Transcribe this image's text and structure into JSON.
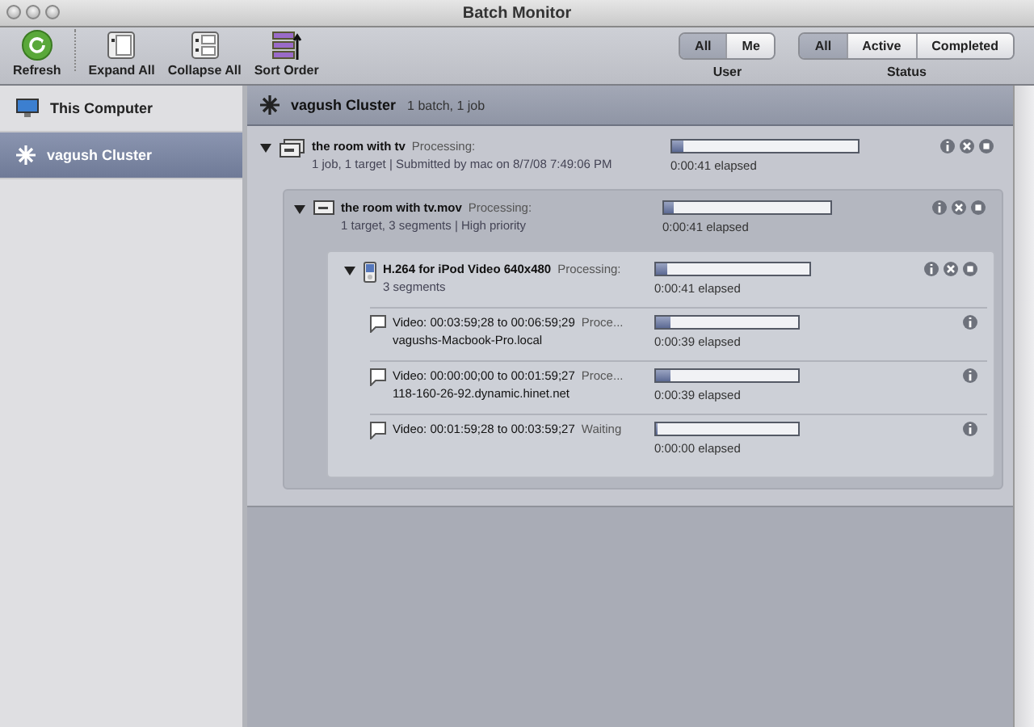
{
  "window": {
    "title": "Batch Monitor"
  },
  "toolbar": {
    "buttons": [
      {
        "label": "Refresh",
        "kind": "refresh"
      },
      {
        "label": "Expand All",
        "kind": "expand"
      },
      {
        "label": "Collapse All",
        "kind": "collapse"
      },
      {
        "label": "Sort Order",
        "kind": "sort"
      }
    ],
    "filters": [
      {
        "label": "User",
        "options": [
          {
            "label": "All",
            "selected": true
          },
          {
            "label": "Me",
            "selected": false
          }
        ]
      },
      {
        "label": "Status",
        "options": [
          {
            "label": "All",
            "selected": true
          },
          {
            "label": "Active",
            "selected": false
          },
          {
            "label": "Completed",
            "selected": false
          }
        ]
      }
    ]
  },
  "sidebar": {
    "items": [
      {
        "label": "This Computer",
        "kind": "computer",
        "selected": false
      },
      {
        "label": "vagush Cluster",
        "kind": "cluster",
        "selected": true
      }
    ]
  },
  "cluster": {
    "name": "vagush Cluster",
    "summary": "1 batch, 1 job"
  },
  "batches": [
    {
      "kind": "batch",
      "expanded": true,
      "title": "the room with tv",
      "status": "Processing:",
      "details": "1 job, 1 target  |  Submitted by mac on 8/7/08 7:49:06 PM",
      "level": 0.06,
      "elapsed": "0:00:41 elapsed",
      "children": [
        {
          "kind": "job",
          "expanded": true,
          "title": "the room with tv.mov",
          "status": "Processing:",
          "details": "1 target, 3 segments  |  High priority",
          "level": 0.06,
          "elapsed": "0:00:41 elapsed",
          "children": [
            {
              "kind": "target",
              "expanded": true,
              "title": "H.264 for iPod Video 640x480",
              "status": "Processing:",
              "details": "3 segments",
              "level": 0.07,
              "elapsed": "0:00:41 elapsed",
              "children": [
                {
                  "kind": "segment",
                  "title": "Video: 00:03:59;28 to 00:06:59;29",
                  "status": "Proce...",
                  "details": "vagushs-Macbook-Pro.local",
                  "level": 0.1,
                  "elapsed": "0:00:39 elapsed"
                },
                {
                  "kind": "segment",
                  "title": "Video: 00:00:00;00 to 00:01:59;27",
                  "status": "Proce...",
                  "details": "118-160-26-92.dynamic.hinet.net",
                  "level": 0.1,
                  "elapsed": "0:00:39 elapsed"
                },
                {
                  "kind": "segment",
                  "title": "Video: 00:01:59;28 to 00:03:59;27",
                  "status": "Waiting",
                  "level": 0,
                  "elapsed": "0:00:00 elapsed"
                }
              ]
            }
          ]
        }
      ]
    }
  ]
}
